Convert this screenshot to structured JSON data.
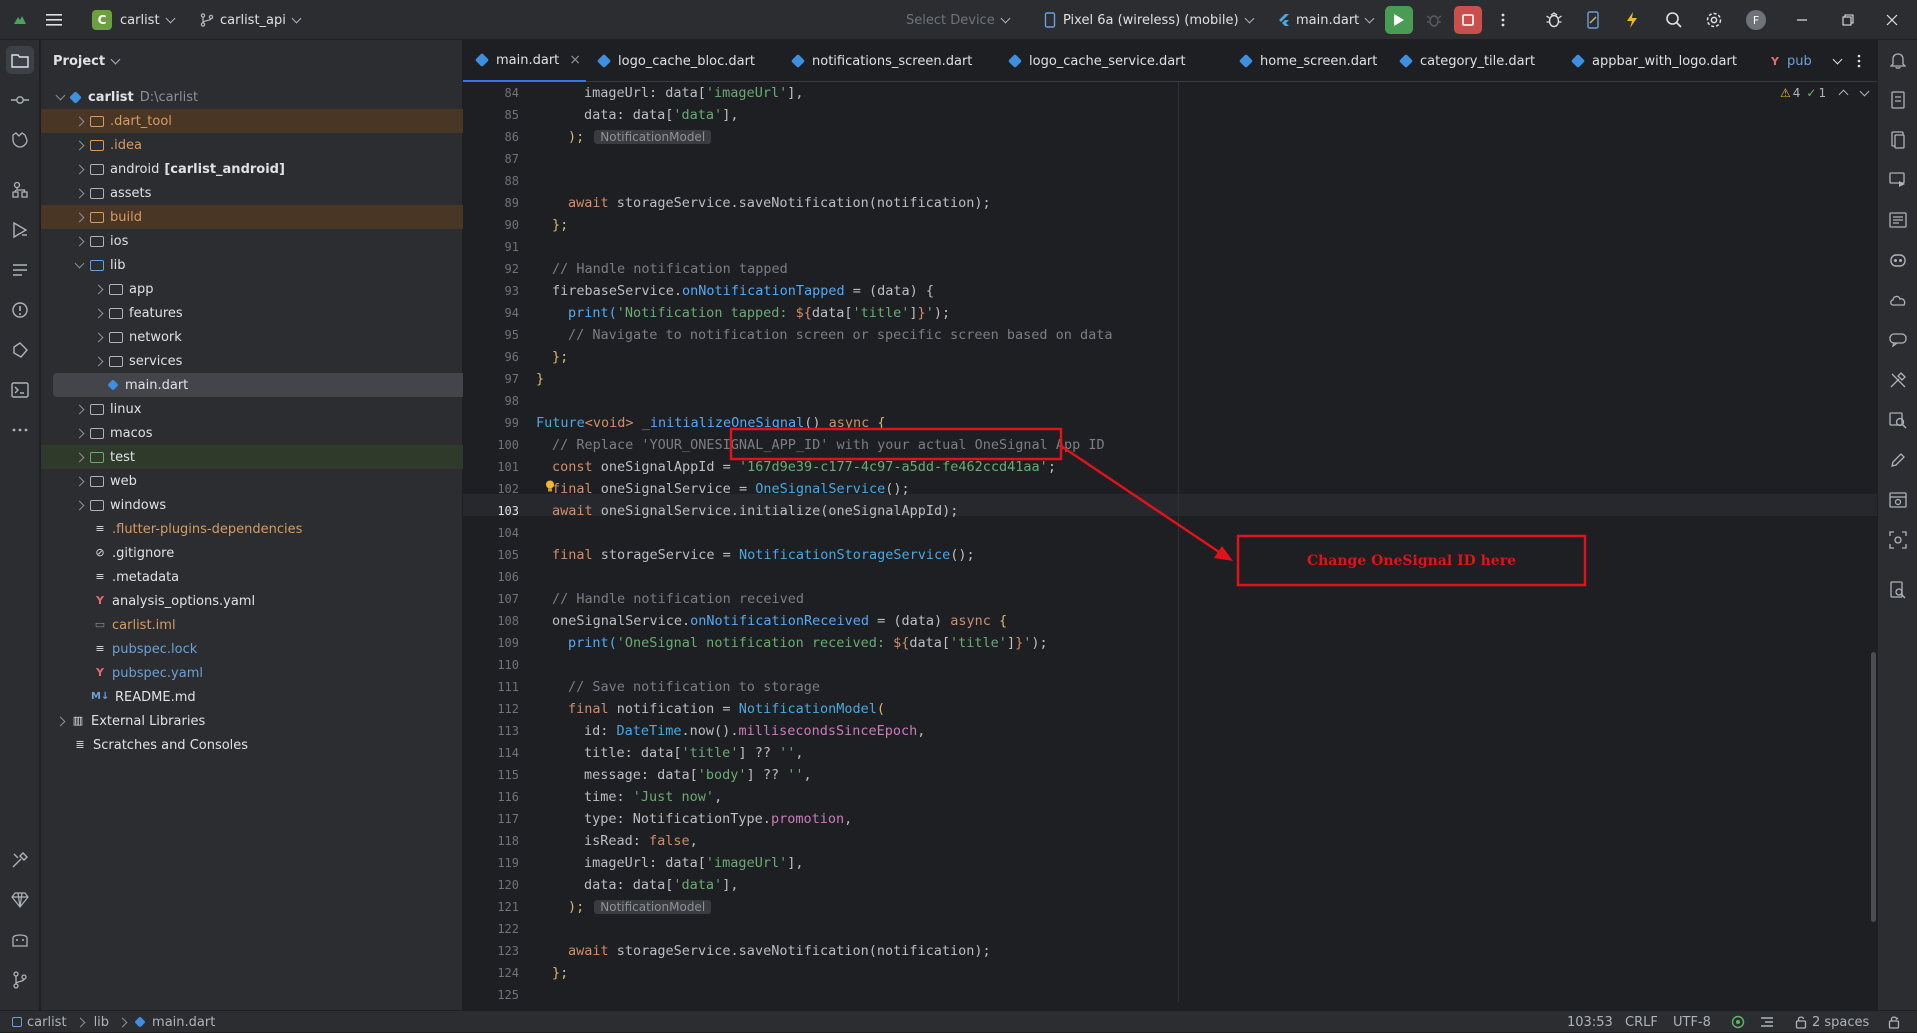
{
  "titlebar": {
    "project_badge": "C",
    "project_name": "carlist",
    "branch": "carlist_api",
    "select_device": "Select Device",
    "device": "Pixel 6a (wireless) (mobile)",
    "run_config": "main.dart",
    "avatar_letter": "F"
  },
  "project_panel": {
    "title": "Project",
    "root_name": "carlist",
    "root_path": "D:\\carlist",
    "items": [
      {
        "label": ".dart_tool",
        "extra": ""
      },
      {
        "label": ".idea",
        "extra": ""
      },
      {
        "label": "android",
        "extra": "[carlist_android]"
      },
      {
        "label": "assets",
        "extra": ""
      },
      {
        "label": "build",
        "extra": ""
      },
      {
        "label": "ios",
        "extra": ""
      },
      {
        "label": "lib",
        "extra": ""
      },
      {
        "label": "app",
        "extra": ""
      },
      {
        "label": "features",
        "extra": ""
      },
      {
        "label": "network",
        "extra": ""
      },
      {
        "label": "services",
        "extra": ""
      },
      {
        "label": "main.dart",
        "extra": ""
      },
      {
        "label": "linux",
        "extra": ""
      },
      {
        "label": "macos",
        "extra": ""
      },
      {
        "label": "test",
        "extra": ""
      },
      {
        "label": "web",
        "extra": ""
      },
      {
        "label": "windows",
        "extra": ""
      },
      {
        "label": ".flutter-plugins-dependencies",
        "extra": ""
      },
      {
        "label": ".gitignore",
        "extra": ""
      },
      {
        "label": ".metadata",
        "extra": ""
      },
      {
        "label": "analysis_options.yaml",
        "extra": ""
      },
      {
        "label": "carlist.iml",
        "extra": ""
      },
      {
        "label": "pubspec.lock",
        "extra": ""
      },
      {
        "label": "pubspec.yaml",
        "extra": ""
      },
      {
        "label": "README.md",
        "extra": ""
      },
      {
        "label": "External Libraries",
        "extra": ""
      },
      {
        "label": "Scratches and Consoles",
        "extra": ""
      }
    ]
  },
  "tabs": [
    {
      "label": "main.dart"
    },
    {
      "label": "logo_cache_bloc.dart"
    },
    {
      "label": "notifications_screen.dart"
    },
    {
      "label": "logo_cache_service.dart"
    },
    {
      "label": "home_screen.dart"
    },
    {
      "label": "category_tile.dart"
    },
    {
      "label": "appbar_with_logo.dart"
    },
    {
      "label": "pub"
    }
  ],
  "inspections": {
    "warnings": "4",
    "ok": "1"
  },
  "code": {
    "line_numbers": [
      "84",
      "85",
      "86",
      "87",
      "88",
      "89",
      "90",
      "91",
      "92",
      "93",
      "94",
      "95",
      "96",
      "97",
      "98",
      "99",
      "100",
      "101",
      "102",
      "103",
      "104",
      "105",
      "106",
      "107",
      "108",
      "109",
      "110",
      "111",
      "112",
      "113",
      "114",
      "115",
      "116",
      "117",
      "118",
      "119",
      "120",
      "121",
      "122",
      "123",
      "124",
      "125"
    ],
    "hint_notification_model": "NotificationModel",
    "l84": {
      "a": "imageUrl: data[",
      "b": "'imageUrl'",
      "c": "],"
    },
    "l85": {
      "a": "data: data[",
      "b": "'data'",
      "c": "],"
    },
    "l86": {
      "a": ");"
    },
    "l88": {
      "a": "await",
      "b": " storageService.saveNotification(notification);"
    },
    "l89": {
      "a": "};"
    },
    "l91": {
      "a": "// Handle notification tapped"
    },
    "l92": {
      "a": "firebaseService.",
      "b": "onNotificationTapped",
      "c": " = (data) {"
    },
    "l93": {
      "a": "print(",
      "b": "'Notification tapped: ",
      "c": "${",
      "d": "data[",
      "e": "'title'",
      "f": "]",
      "g": "}",
      "h": "'",
      "i": ");"
    },
    "l94": {
      "a": "// Navigate to notification screen or specific screen based on data"
    },
    "l95": {
      "a": "};"
    },
    "l96": {
      "a": "}"
    },
    "l98": {
      "a": "Future",
      "b": "<void>",
      "c": " _initializeOneSignal",
      "d": "() ",
      "e": "async",
      "f": " {"
    },
    "l99": {
      "a": "// Replace 'YOUR_ONESIGNAL_APP_ID' with your actual OneSignal App ID"
    },
    "l100": {
      "a": "const",
      "b": " oneSignalAppId = ",
      "c": "'167d9e39-c177-4c97-a5dd-fe462ccd41aa'",
      "d": ";"
    },
    "l102": {
      "a": "final",
      "b": " oneSignalService = ",
      "c": "OneSignalService",
      "d": "();"
    },
    "l103": {
      "a": "await",
      "b": " oneSignalService.initialize(oneSignalAppId);"
    },
    "l105": {
      "a": "final",
      "b": " storageService = ",
      "c": "NotificationStorageService",
      "d": "();"
    },
    "l107": {
      "a": "// Handle notification received"
    },
    "l108": {
      "a": "oneSignalService.",
      "b": "onNotificationReceived",
      "c": " = (data) ",
      "d": "async",
      "e": " {"
    },
    "l109": {
      "a": "print(",
      "b": "'OneSignal notification received: ",
      "c": "${",
      "d": "data[",
      "e": "'title'",
      "f": "]",
      "g": "}",
      "h": "'",
      "i": ");"
    },
    "l111": {
      "a": "// Save notification to storage"
    },
    "l112": {
      "a": "final",
      "b": " notification = ",
      "c": "NotificationModel",
      "d": "("
    },
    "l113": {
      "a": "id: ",
      "b": "DateTime",
      "c": ".now().",
      "d": "millisecondsSinceEpoch",
      "e": ","
    },
    "l114": {
      "a": "title: data[",
      "b": "'title'",
      "c": "] ?? ",
      "d": "''",
      "e": ","
    },
    "l115": {
      "a": "message: data[",
      "b": "'body'",
      "c": "] ?? ",
      "d": "''",
      "e": ","
    },
    "l116": {
      "a": "time: ",
      "b": "'Just now'",
      "c": ","
    },
    "l117": {
      "a": "type: NotificationType.",
      "b": "promotion",
      "c": ","
    },
    "l118": {
      "a": "isRead: ",
      "b": "false",
      "c": ","
    },
    "l119": {
      "a": "imageUrl: data[",
      "b": "'imageUrl'",
      "c": "],"
    },
    "l120": {
      "a": "data: data[",
      "b": "'data'",
      "c": "],"
    },
    "l121": {
      "a": ");"
    },
    "l123": {
      "a": "await",
      "b": " storageService.saveNotification(notification);"
    },
    "l124": {
      "a": "};"
    }
  },
  "annotation": {
    "label": "Change OneSignal ID here",
    "color": "#e0121b"
  },
  "statusbar": {
    "crumbs": [
      "carlist",
      "lib",
      "main.dart"
    ],
    "position": "103:53",
    "line_sep": "CRLF",
    "encoding": "UTF-8",
    "indent": "2 spaces"
  },
  "colors": {
    "accent": "#3574f0",
    "run": "#499c54",
    "stop": "#c94f4f"
  }
}
